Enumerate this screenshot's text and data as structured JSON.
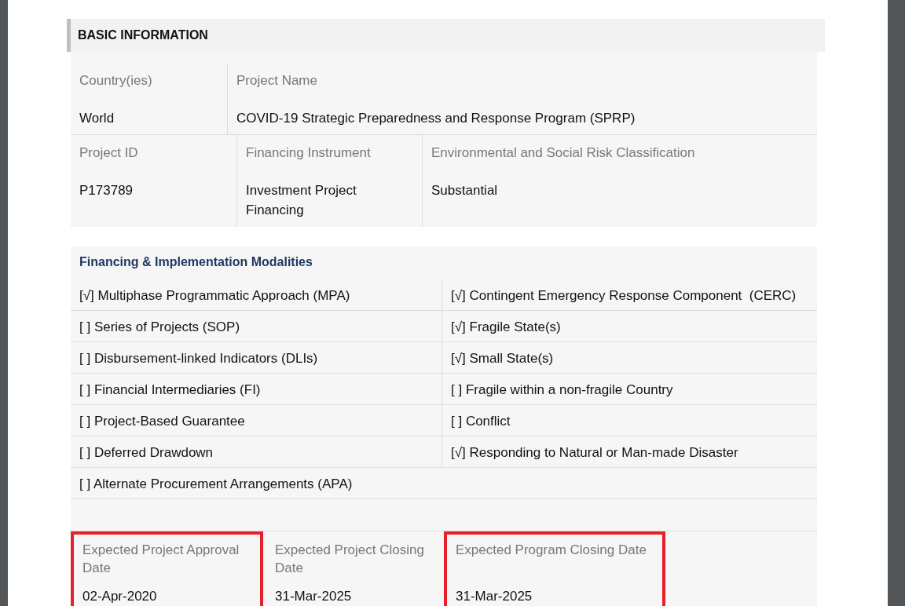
{
  "section_title": "BASIC INFORMATION",
  "basic_rows": [
    {
      "fields": [
        {
          "label": "Country(ies)",
          "value": "World"
        },
        {
          "label": "Project Name",
          "value": "COVID-19 Strategic Preparedness and Response Program (SPRP)"
        }
      ]
    },
    {
      "fields": [
        {
          "label": "Project ID",
          "value": "P173789"
        },
        {
          "label": "Financing Instrument",
          "value": "Investment Project Financing"
        },
        {
          "label": "Environmental and Social Risk Classification",
          "value": "Substantial"
        }
      ]
    }
  ],
  "modalities": {
    "title": "Financing & Implementation Modalities",
    "rows": [
      [
        "[√] Multiphase Programmatic Approach (MPA)",
        "[√] Contingent Emergency Response Component  (CERC)"
      ],
      [
        "[ ] Series of Projects (SOP)",
        "[√] Fragile State(s)"
      ],
      [
        "[ ] Disbursement-linked Indicators (DLIs)",
        "[√] Small State(s)"
      ],
      [
        "[ ] Financial Intermediaries (FI)",
        "[ ] Fragile within a non-fragile Country"
      ],
      [
        "[ ] Project-Based Guarantee",
        "[ ] Conflict"
      ],
      [
        "[ ] Deferred Drawdown",
        "[√] Responding to Natural or Man-made Disaster"
      ],
      [
        "[ ] Alternate Procurement Arrangements (APA)"
      ]
    ]
  },
  "dates": [
    {
      "label": "Expected Project Approval Date",
      "value": "02-Apr-2020",
      "highlighted": true
    },
    {
      "label": "Expected Project Closing Date",
      "value": "31-Mar-2025",
      "highlighted": false
    },
    {
      "label": "Expected Program Closing Date",
      "value": "31-Mar-2025",
      "highlighted": true
    }
  ]
}
